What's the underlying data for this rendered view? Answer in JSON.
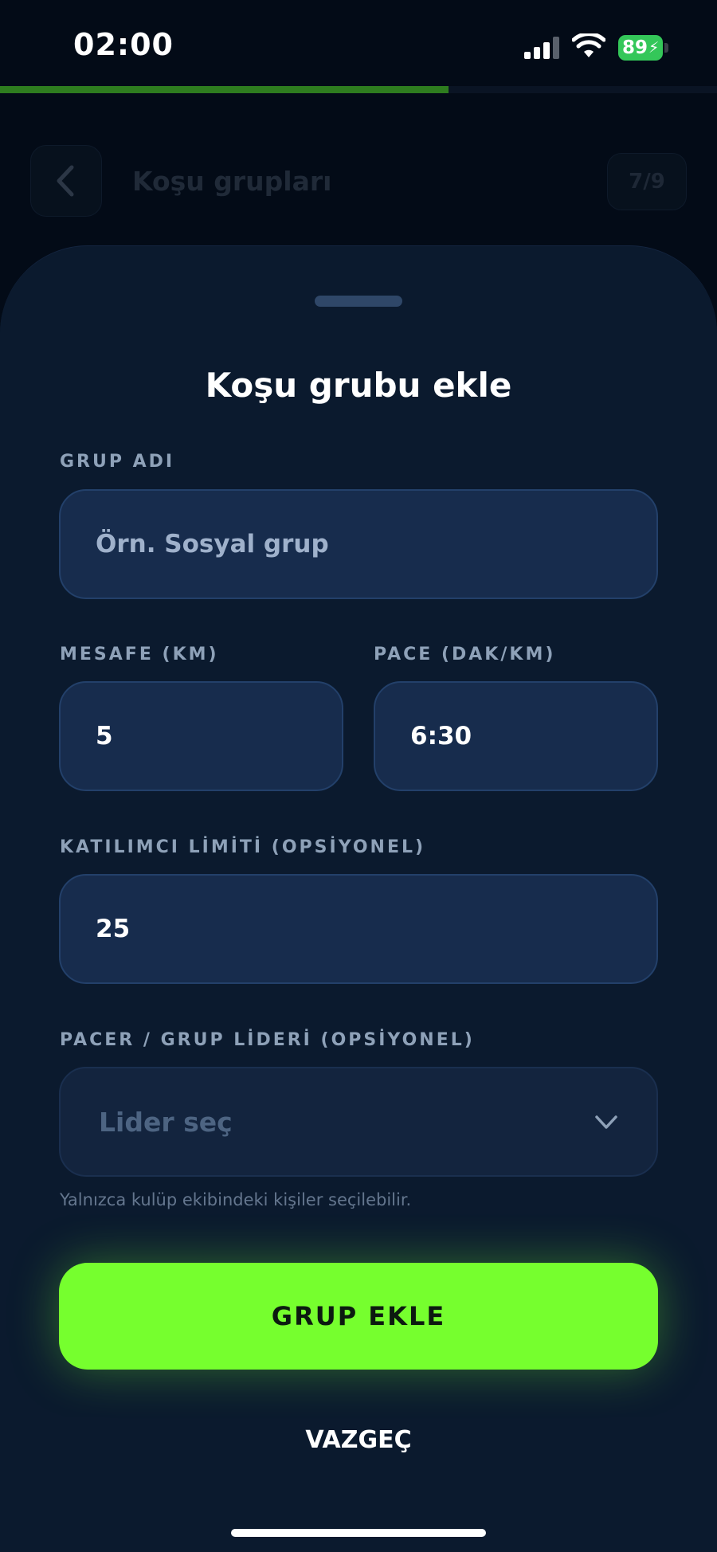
{
  "status_bar": {
    "time": "02:00",
    "battery": "89"
  },
  "progress": {
    "fraction": 0.625
  },
  "header": {
    "title": "Koşu grupları",
    "step": "7/9"
  },
  "sheet": {
    "title": "Koşu grubu ekle",
    "group_name": {
      "label": "GRUP ADI",
      "placeholder": "Örn. Sosyal grup"
    },
    "distance": {
      "label": "MESAFE (KM)",
      "value": "5"
    },
    "pace": {
      "label": "PACE (DAK/KM)",
      "value": "6:30"
    },
    "participant_limit": {
      "label": "KATILIMCI LİMİTİ (OPSİYONEL)",
      "value": "25"
    },
    "pacer": {
      "label": "PACER / GRUP LİDERİ (OPSİYONEL)",
      "placeholder": "Lider seç",
      "helper": "Yalnızca kulüp ekibindeki kişiler seçilebilir."
    },
    "primary_button": "GRUP EKLE",
    "cancel_button": "VAZGEÇ"
  },
  "colors": {
    "accent": "#76ff2e",
    "background": "#030b17",
    "sheet": "#0b1a2e",
    "input": "#172c4d"
  },
  "icons": {
    "back": "chevron-left-icon",
    "dropdown": "chevron-down-icon",
    "signal": "cellular-signal-icon",
    "wifi": "wifi-icon",
    "battery": "battery-charging-icon"
  }
}
